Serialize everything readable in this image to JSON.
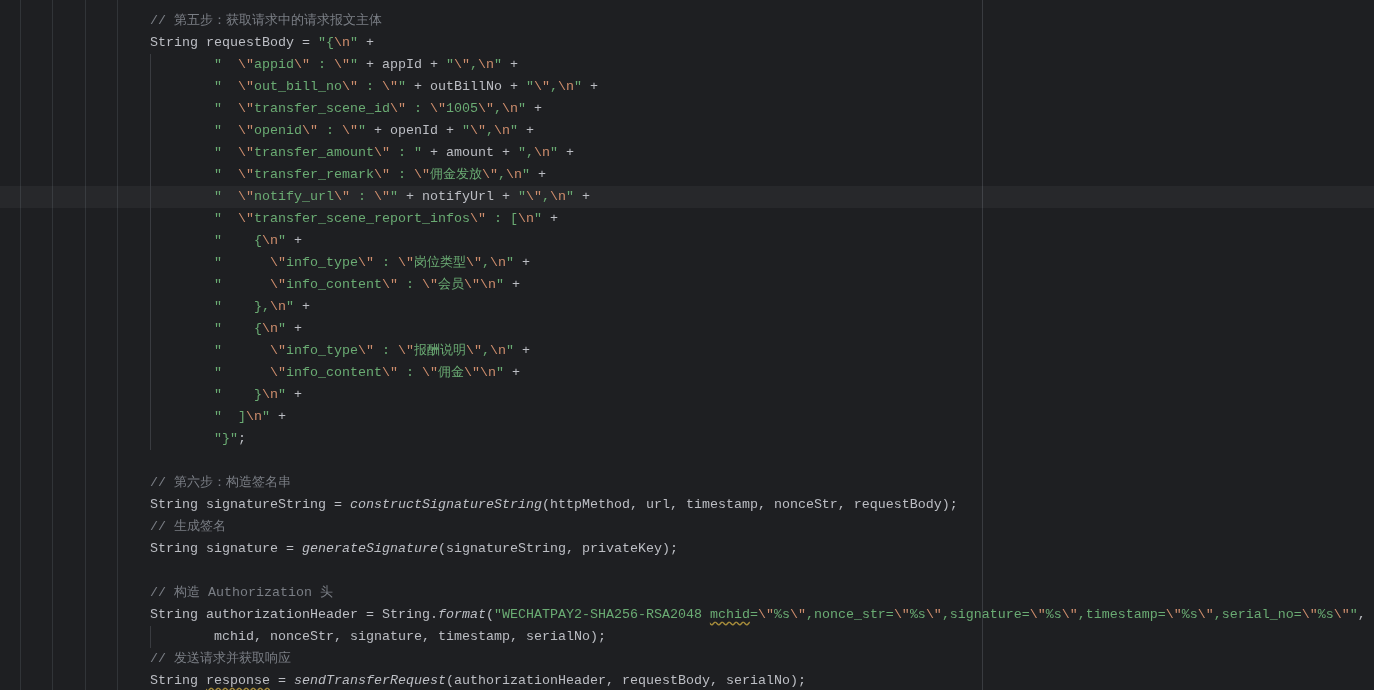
{
  "editor": {
    "lines": [
      {
        "kind": "statement",
        "current": false,
        "tokens": [
          {
            "kind": "comment",
            "text": "// 第五步：获取请求中的请求报文主体"
          }
        ]
      },
      {
        "kind": "statement",
        "current": false,
        "tokens": [
          {
            "kind": "plain",
            "text": "String requestBody = "
          },
          {
            "kind": "string",
            "text": "\"{\\n\""
          },
          {
            "kind": "plain",
            "text": " +"
          }
        ]
      },
      {
        "kind": "continuation",
        "current": false,
        "tokens": [
          {
            "kind": "string",
            "text": "\"  \\\"appid\\\" : \\\"\""
          },
          {
            "kind": "plain",
            "text": " + appId + "
          },
          {
            "kind": "string",
            "text": "\"\\\",\\n\""
          },
          {
            "kind": "plain",
            "text": " +"
          }
        ]
      },
      {
        "kind": "continuation",
        "current": false,
        "tokens": [
          {
            "kind": "string",
            "text": "\"  \\\"out_bill_no\\\" : \\\"\""
          },
          {
            "kind": "plain",
            "text": " + outBillNo + "
          },
          {
            "kind": "string",
            "text": "\"\\\",\\n\""
          },
          {
            "kind": "plain",
            "text": " +"
          }
        ]
      },
      {
        "kind": "continuation",
        "current": false,
        "tokens": [
          {
            "kind": "string",
            "text": "\"  \\\"transfer_scene_id\\\" : \\\"1005\\\",\\n\""
          },
          {
            "kind": "plain",
            "text": " +"
          }
        ]
      },
      {
        "kind": "continuation",
        "current": false,
        "tokens": [
          {
            "kind": "string",
            "text": "\"  \\\"openid\\\" : \\\"\""
          },
          {
            "kind": "plain",
            "text": " + openId + "
          },
          {
            "kind": "string",
            "text": "\"\\\",\\n\""
          },
          {
            "kind": "plain",
            "text": " +"
          }
        ]
      },
      {
        "kind": "continuation",
        "current": false,
        "tokens": [
          {
            "kind": "string",
            "text": "\"  \\\"transfer_amount\\\" : \""
          },
          {
            "kind": "plain",
            "text": " + amount + "
          },
          {
            "kind": "string",
            "text": "\",\\n\""
          },
          {
            "kind": "plain",
            "text": " +"
          }
        ]
      },
      {
        "kind": "continuation",
        "current": false,
        "tokens": [
          {
            "kind": "string",
            "text": "\"  \\\"transfer_remark\\\" : \\\"佣金发放\\\",\\n\""
          },
          {
            "kind": "plain",
            "text": " +"
          }
        ]
      },
      {
        "kind": "continuation",
        "current": true,
        "tokens": [
          {
            "kind": "string",
            "text": "\"  \\\"notify_url\\\" : \\\"\""
          },
          {
            "kind": "plain",
            "text": " + notifyUrl + "
          },
          {
            "kind": "string",
            "text": "\"\\\",\\n\""
          },
          {
            "kind": "plain",
            "text": " +"
          }
        ]
      },
      {
        "kind": "continuation",
        "current": false,
        "tokens": [
          {
            "kind": "string",
            "text": "\"  \\\"transfer_scene_report_infos\\\" : [\\n\""
          },
          {
            "kind": "plain",
            "text": " +"
          }
        ]
      },
      {
        "kind": "continuation",
        "current": false,
        "tokens": [
          {
            "kind": "string",
            "text": "\"    {\\n\""
          },
          {
            "kind": "plain",
            "text": " +"
          }
        ]
      },
      {
        "kind": "continuation",
        "current": false,
        "tokens": [
          {
            "kind": "string",
            "text": "\"      \\\"info_type\\\" : \\\"岗位类型\\\",\\n\""
          },
          {
            "kind": "plain",
            "text": " +"
          }
        ]
      },
      {
        "kind": "continuation",
        "current": false,
        "tokens": [
          {
            "kind": "string",
            "text": "\"      \\\"info_content\\\" : \\\"会员\\\"\\n\""
          },
          {
            "kind": "plain",
            "text": " +"
          }
        ]
      },
      {
        "kind": "continuation",
        "current": false,
        "tokens": [
          {
            "kind": "string",
            "text": "\"    },\\n\""
          },
          {
            "kind": "plain",
            "text": " +"
          }
        ]
      },
      {
        "kind": "continuation",
        "current": false,
        "tokens": [
          {
            "kind": "string",
            "text": "\"    {\\n\""
          },
          {
            "kind": "plain",
            "text": " +"
          }
        ]
      },
      {
        "kind": "continuation",
        "current": false,
        "tokens": [
          {
            "kind": "string",
            "text": "\"      \\\"info_type\\\" : \\\"报酬说明\\\",\\n\""
          },
          {
            "kind": "plain",
            "text": " +"
          }
        ]
      },
      {
        "kind": "continuation",
        "current": false,
        "tokens": [
          {
            "kind": "string",
            "text": "\"      \\\"info_content\\\" : \\\"佣金\\\"\\n\""
          },
          {
            "kind": "plain",
            "text": " +"
          }
        ]
      },
      {
        "kind": "continuation",
        "current": false,
        "tokens": [
          {
            "kind": "string",
            "text": "\"    }\\n\""
          },
          {
            "kind": "plain",
            "text": " +"
          }
        ]
      },
      {
        "kind": "continuation",
        "current": false,
        "tokens": [
          {
            "kind": "string",
            "text": "\"  ]\\n\""
          },
          {
            "kind": "plain",
            "text": " +"
          }
        ]
      },
      {
        "kind": "continuation",
        "current": false,
        "tokens": [
          {
            "kind": "string",
            "text": "\"}\""
          },
          {
            "kind": "plain",
            "text": ";"
          }
        ]
      },
      {
        "kind": "blank"
      },
      {
        "kind": "statement",
        "current": false,
        "tokens": [
          {
            "kind": "comment",
            "text": "// 第六步：构造签名串"
          }
        ]
      },
      {
        "kind": "statement",
        "current": false,
        "tokens": [
          {
            "kind": "plain",
            "text": "String signatureString = "
          },
          {
            "kind": "call",
            "text": "constructSignatureString"
          },
          {
            "kind": "plain",
            "text": "(httpMethod, url, timestamp, nonceStr, requestBody);"
          }
        ]
      },
      {
        "kind": "statement",
        "current": false,
        "tokens": [
          {
            "kind": "comment",
            "text": "// 生成签名"
          }
        ]
      },
      {
        "kind": "statement",
        "current": false,
        "tokens": [
          {
            "kind": "plain",
            "text": "String signature = "
          },
          {
            "kind": "call",
            "text": "generateSignature"
          },
          {
            "kind": "plain",
            "text": "(signatureString, privateKey);"
          }
        ]
      },
      {
        "kind": "blank"
      },
      {
        "kind": "statement",
        "current": false,
        "tokens": [
          {
            "kind": "comment",
            "text": "// 构造 Authorization 头"
          }
        ]
      },
      {
        "kind": "statement",
        "current": false,
        "tokens": [
          {
            "kind": "plain",
            "text": "String authorizationHeader = String."
          },
          {
            "kind": "call",
            "text": "format"
          },
          {
            "kind": "plain",
            "text": "("
          },
          {
            "kind": "string",
            "text": "\"WECHATPAY2-SHA256-RSA2048 "
          },
          {
            "kind": "string",
            "text": "mchid",
            "warning": true
          },
          {
            "kind": "string",
            "text": "=\\\"%s\\\",nonce_str=\\\"%s\\\",signature=\\\"%s\\\",timestamp=\\\"%s\\\",serial_no=\\\"%s\\\"\""
          },
          {
            "kind": "plain",
            "text": ","
          }
        ]
      },
      {
        "kind": "continuation",
        "current": false,
        "tokens": [
          {
            "kind": "plain",
            "text": "mchid, nonceStr, signature, timestamp, serialNo);"
          }
        ]
      },
      {
        "kind": "statement",
        "current": false,
        "tokens": [
          {
            "kind": "comment",
            "text": "// 发送请求并获取响应"
          }
        ]
      },
      {
        "kind": "statement",
        "current": false,
        "tokens": [
          {
            "kind": "plain",
            "text": "String "
          },
          {
            "kind": "plain",
            "text": "response",
            "warning": true
          },
          {
            "kind": "plain",
            "text": " = "
          },
          {
            "kind": "call",
            "text": "sendTransferRequest"
          },
          {
            "kind": "plain",
            "text": "(authorizationHeader, requestBody, serialNo);"
          }
        ]
      }
    ]
  }
}
